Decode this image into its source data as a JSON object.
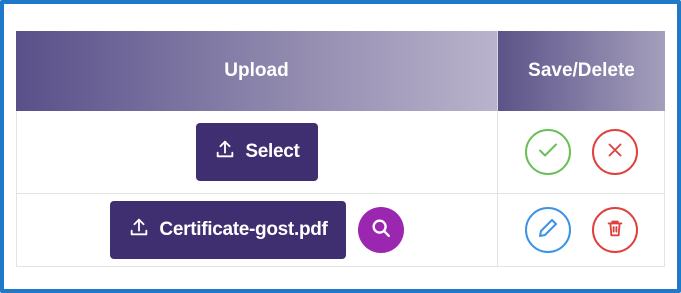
{
  "table": {
    "headers": {
      "upload": "Upload",
      "save_delete": "Save/Delete"
    },
    "rows": [
      {
        "upload_label": "Select",
        "actions": [
          "confirm",
          "cancel"
        ]
      },
      {
        "upload_label": "Certificate-gost.pdf",
        "has_preview": true,
        "actions": [
          "edit",
          "delete"
        ]
      }
    ]
  },
  "colors": {
    "button": "#3f2e70",
    "preview": "#9b27b0",
    "confirm": "#6bbf58",
    "cancel": "#e0403d",
    "edit": "#3b93e6",
    "frame": "#1f78c8"
  },
  "icons": {
    "upload": "upload-icon",
    "search": "search-icon",
    "confirm": "check-icon",
    "cancel": "close-icon",
    "edit": "pencil-icon",
    "delete": "trash-icon"
  }
}
